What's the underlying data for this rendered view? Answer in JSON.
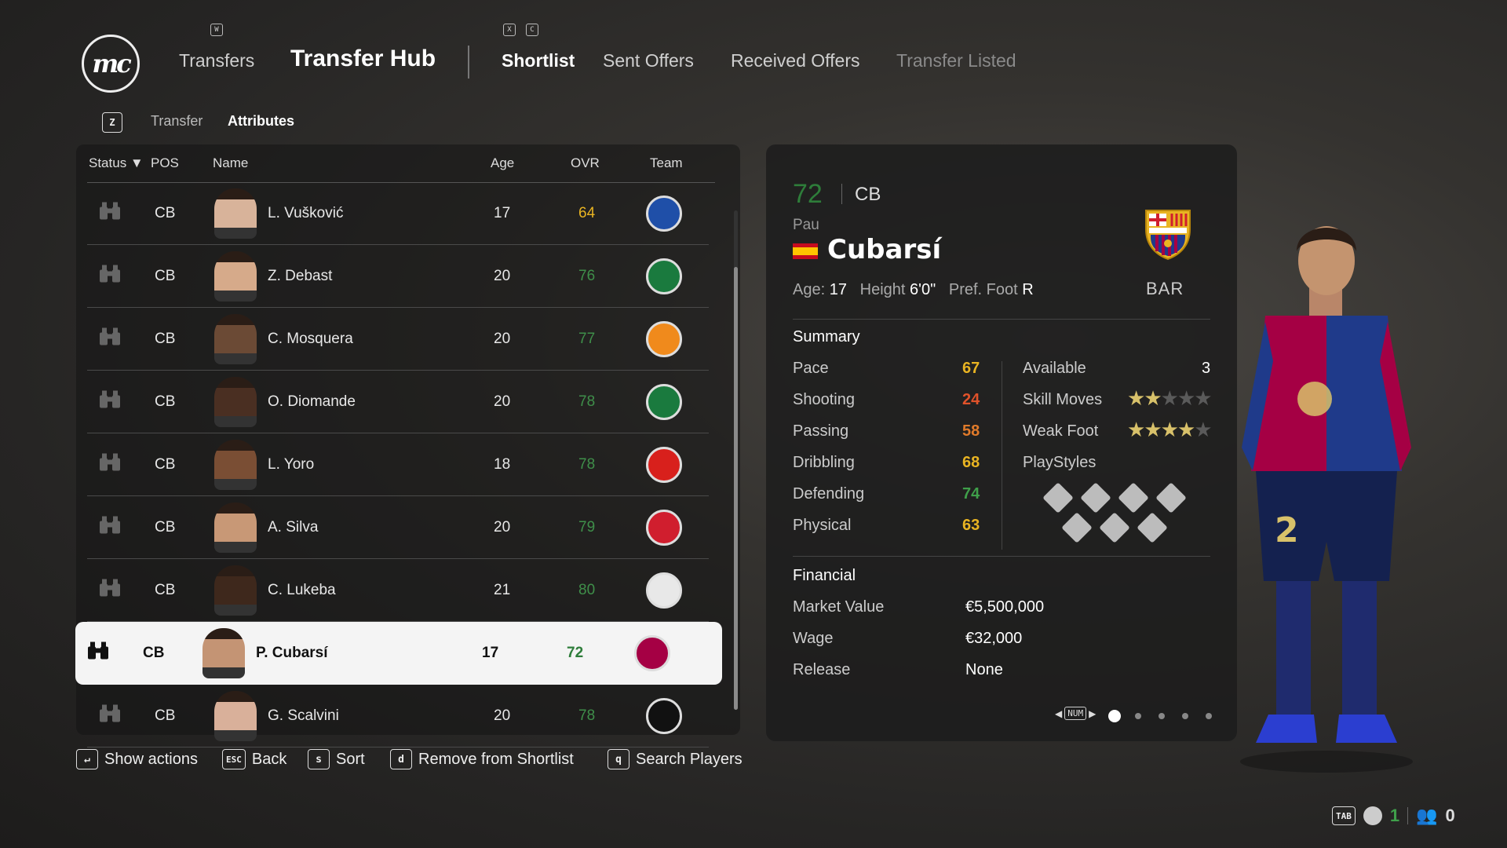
{
  "header": {
    "logo_text": "mc",
    "key_w": "W",
    "key_x": "X",
    "key_c": "C",
    "transfers": "Transfers",
    "title": "Transfer Hub",
    "tabs": [
      "Shortlist",
      "Sent Offers",
      "Received Offers",
      "Transfer Listed"
    ]
  },
  "subnav": {
    "key": "Z",
    "items": [
      "Transfer",
      "Attributes"
    ]
  },
  "list": {
    "columns": {
      "status": "Status",
      "pos": "POS",
      "name": "Name",
      "age": "Age",
      "ovr": "OVR",
      "team": "Team"
    },
    "rows": [
      {
        "pos": "CB",
        "name": "L. Vušković",
        "age": "17",
        "ovr": "64",
        "ovr_color": "#e9b422",
        "team_color": "#1f4fa8",
        "skin": "#d8b39a"
      },
      {
        "pos": "CB",
        "name": "Z. Debast",
        "age": "20",
        "ovr": "76",
        "ovr_color": "#3f8f4a",
        "team_color": "#1a7a3e",
        "skin": "#d6aa8a"
      },
      {
        "pos": "CB",
        "name": "C. Mosquera",
        "age": "20",
        "ovr": "77",
        "ovr_color": "#3f8f4a",
        "team_color": "#f08a1c",
        "skin": "#6b4a35"
      },
      {
        "pos": "CB",
        "name": "O. Diomande",
        "age": "20",
        "ovr": "78",
        "ovr_color": "#3f8f4a",
        "team_color": "#1a7a3e",
        "skin": "#4a2f22"
      },
      {
        "pos": "CB",
        "name": "L. Yoro",
        "age": "18",
        "ovr": "78",
        "ovr_color": "#3f8f4a",
        "team_color": "#d8201c",
        "skin": "#7a4e34"
      },
      {
        "pos": "CB",
        "name": "A. Silva",
        "age": "20",
        "ovr": "79",
        "ovr_color": "#3f8f4a",
        "team_color": "#d01e2e",
        "skin": "#c89876"
      },
      {
        "pos": "CB",
        "name": "C. Lukeba",
        "age": "21",
        "ovr": "80",
        "ovr_color": "#3f8f4a",
        "team_color": "#e8e8e8",
        "skin": "#3e281c"
      },
      {
        "pos": "CB",
        "name": "P. Cubarsí",
        "age": "17",
        "ovr": "72",
        "ovr_color": "#2e7d3a",
        "team_color": "#a50044",
        "skin": "#c49474",
        "selected": true
      },
      {
        "pos": "CB",
        "name": "G. Scalvini",
        "age": "20",
        "ovr": "78",
        "ovr_color": "#3f8f4a",
        "team_color": "#111111",
        "skin": "#d9b09a"
      }
    ]
  },
  "player": {
    "ovr": "72",
    "pos": "CB",
    "first_name": "Pau",
    "last_name": "Cubarsí",
    "age_label": "Age:",
    "age": "17",
    "height_label": "Height",
    "height": "6'0\"",
    "foot_label": "Pref. Foot",
    "foot": "R",
    "club_abbr": "BAR",
    "summary_title": "Summary",
    "stats": [
      {
        "label": "Pace",
        "value": "67",
        "color": "#e9b422"
      },
      {
        "label": "Shooting",
        "value": "24",
        "color": "#e0522a"
      },
      {
        "label": "Passing",
        "value": "58",
        "color": "#e07a2a"
      },
      {
        "label": "Dribbling",
        "value": "68",
        "color": "#e9b422"
      },
      {
        "label": "Defending",
        "value": "74",
        "color": "#3f9f4a"
      },
      {
        "label": "Physical",
        "value": "63",
        "color": "#e9b422"
      }
    ],
    "available_label": "Available",
    "available": "3",
    "skill_moves_label": "Skill Moves",
    "skill_moves": 2,
    "weak_foot_label": "Weak Foot",
    "weak_foot": 4,
    "playstyles_label": "PlayStyles",
    "financial_title": "Financial",
    "financial": [
      {
        "label": "Market Value",
        "value": "€5,500,000"
      },
      {
        "label": "Wage",
        "value": "€32,000"
      },
      {
        "label": "Release",
        "value": "None"
      }
    ],
    "pager_key": "NUM"
  },
  "footer": {
    "actions": [
      {
        "key": "↵",
        "label": "Show actions"
      },
      {
        "key": "ESC",
        "label": "Back"
      },
      {
        "key": "s",
        "label": "Sort"
      },
      {
        "key": "d",
        "label": "Remove from Shortlist"
      },
      {
        "key": "q",
        "label": "Search Players"
      }
    ],
    "tab_key": "TAB",
    "count_a": "1",
    "count_b": "0"
  }
}
